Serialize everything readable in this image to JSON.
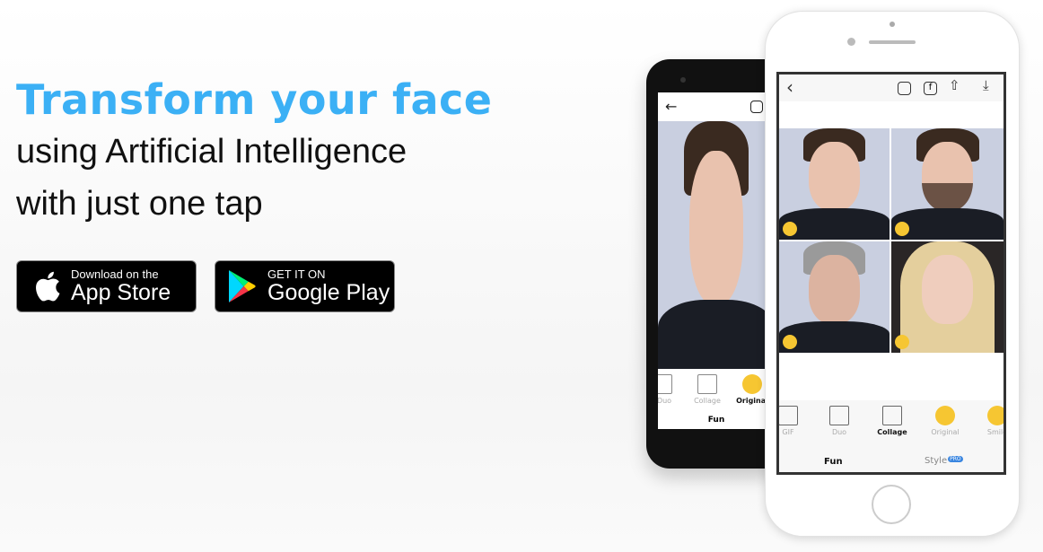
{
  "hero": {
    "headline": "Transform your face",
    "line1": "using Artificial Intelligence",
    "line2": "with just one tap"
  },
  "app_store": {
    "small": "Download on the",
    "big": "App Store"
  },
  "google_play": {
    "small": "GET IT ON",
    "big": "Google Play"
  },
  "android": {
    "tools": [
      "Duo",
      "Collage",
      "Original"
    ],
    "tab": "Fun"
  },
  "iphone": {
    "tools": [
      "GIF",
      "Duo",
      "Collage",
      "Original",
      "Smile"
    ],
    "active_tool": "Collage",
    "tabs": [
      "Fun",
      "Style"
    ],
    "pro_badge": "PRO"
  },
  "colors": {
    "accent": "#3bb0f5",
    "pro": "#3a86e0"
  }
}
